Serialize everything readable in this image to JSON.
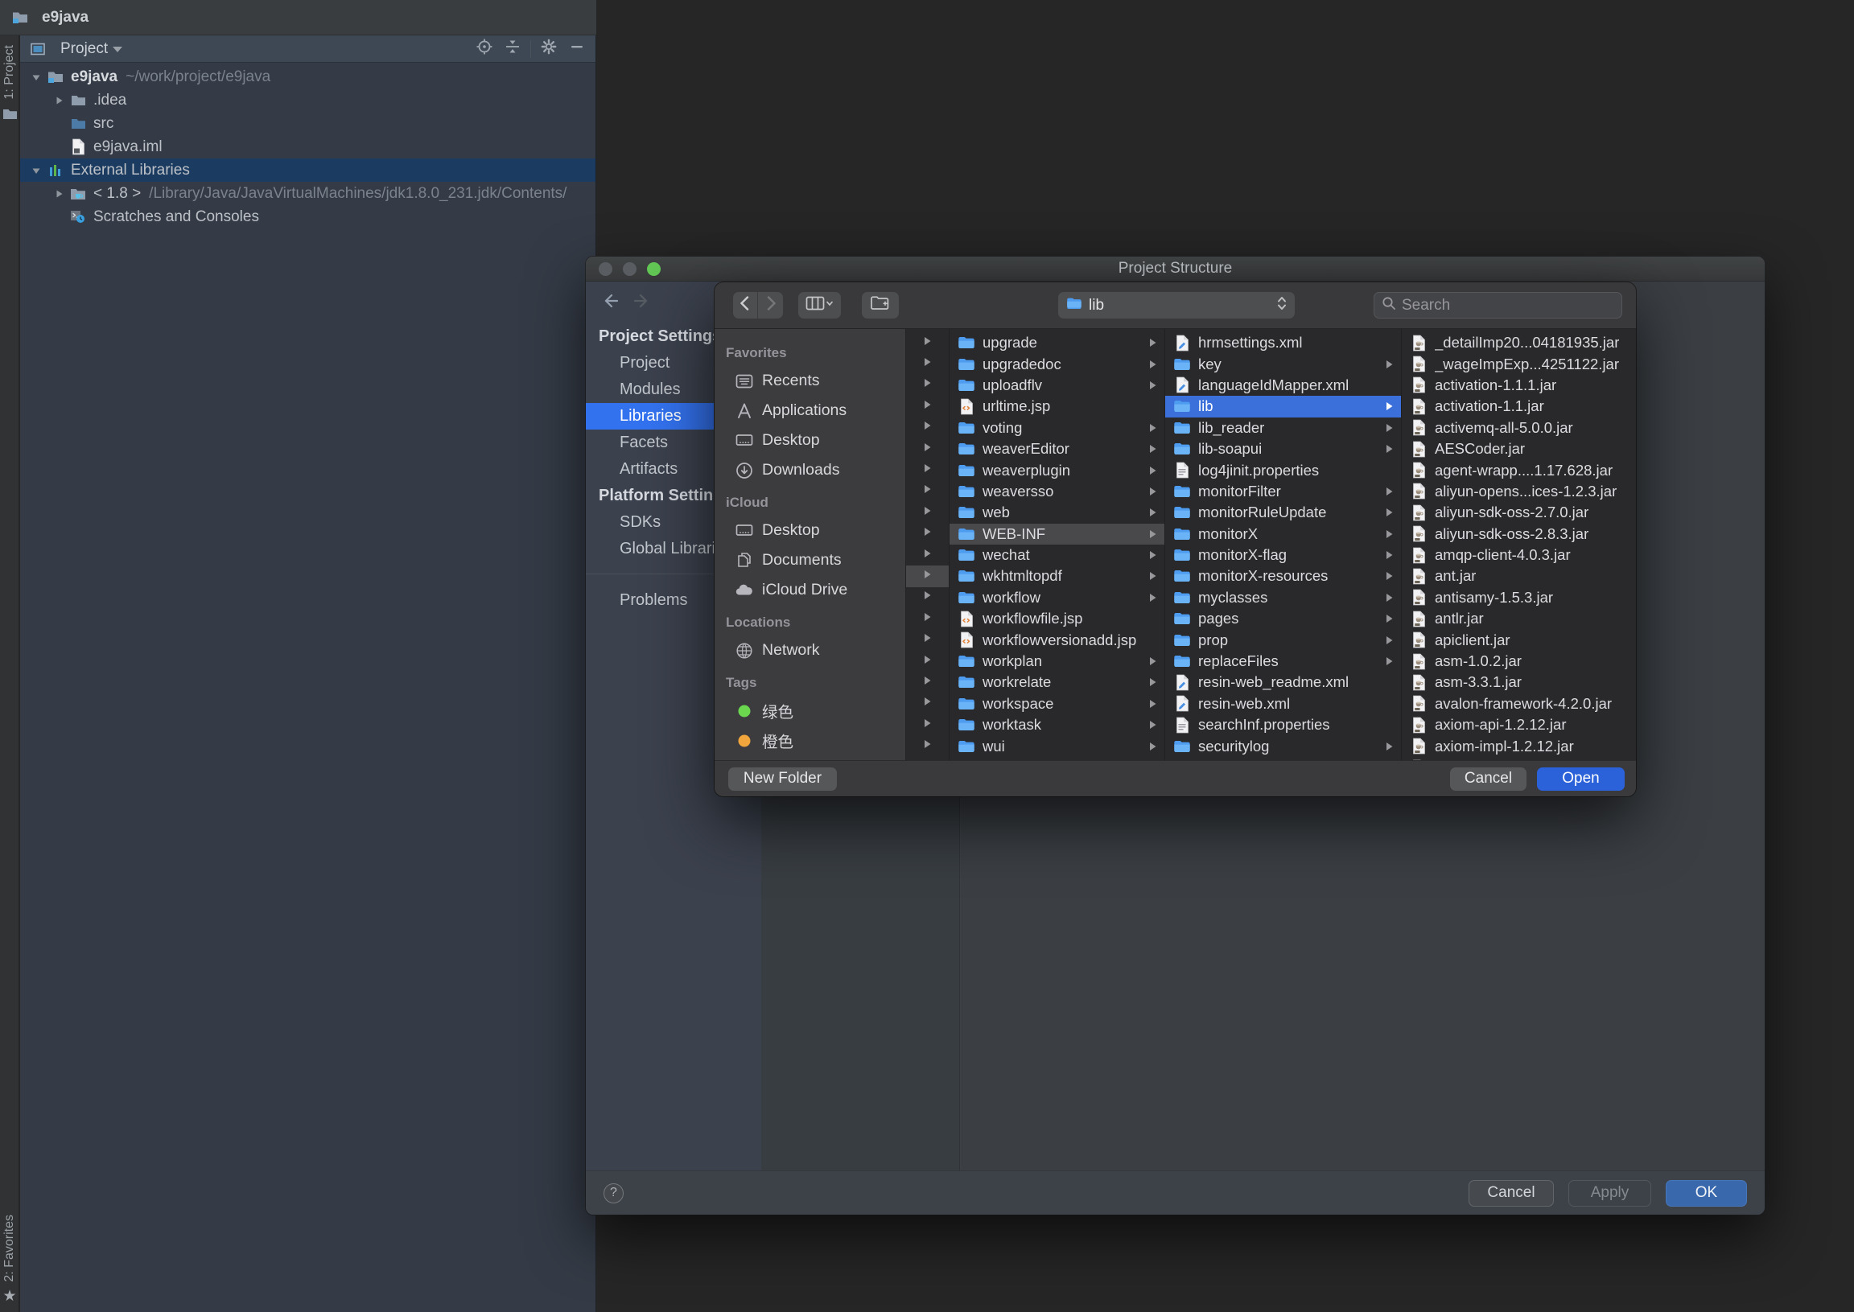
{
  "window": {
    "title": "e9java"
  },
  "tool_stripes": {
    "left_top": "1: Project",
    "left_bottom": "2: Favorites"
  },
  "project_panel": {
    "header_title": "Project",
    "tree": [
      {
        "label": "e9java",
        "hint": "~/work/project/e9java",
        "icon": "project-root",
        "expander": "open",
        "indent": 0,
        "bold": true
      },
      {
        "label": ".idea",
        "icon": "folder-grey",
        "expander": "closed",
        "indent": 1
      },
      {
        "label": "src",
        "icon": "folder-blue",
        "expander": "none",
        "indent": 1
      },
      {
        "label": "e9java.iml",
        "icon": "iml-file",
        "expander": "none",
        "indent": 1
      },
      {
        "label": "External Libraries",
        "icon": "libraries",
        "expander": "open",
        "indent": 0,
        "selected": true
      },
      {
        "label": "< 1.8 >",
        "hint": "/Library/Java/JavaVirtualMachines/jdk1.8.0_231.jdk/Contents/",
        "icon": "jdk",
        "expander": "closed",
        "indent": 1
      },
      {
        "label": "Scratches and Consoles",
        "icon": "scratches",
        "expander": "none",
        "indent": 1
      }
    ]
  },
  "project_structure": {
    "title": "Project Structure",
    "sidebar_sections": [
      {
        "header": "Project Settings",
        "items": [
          {
            "label": "Project"
          },
          {
            "label": "Modules"
          },
          {
            "label": "Libraries",
            "selected": true
          },
          {
            "label": "Facets"
          },
          {
            "label": "Artifacts"
          }
        ]
      },
      {
        "header": "Platform Settings",
        "items": [
          {
            "label": "SDKs"
          },
          {
            "label": "Global Libraries"
          }
        ]
      },
      {
        "header": "",
        "divider": true,
        "items": [
          {
            "label": "Problems"
          }
        ]
      }
    ],
    "footer": {
      "help": "?",
      "cancel": "Cancel",
      "apply": "Apply",
      "ok": "OK"
    }
  },
  "file_chooser": {
    "toolbar": {
      "location": "lib",
      "search_placeholder": "Search"
    },
    "sidebar": [
      {
        "title": "Favorites",
        "items": [
          {
            "label": "Recents",
            "icon": "recents"
          },
          {
            "label": "Applications",
            "icon": "applications"
          },
          {
            "label": "Desktop",
            "icon": "desktop"
          },
          {
            "label": "Downloads",
            "icon": "downloads"
          }
        ]
      },
      {
        "title": "iCloud",
        "items": [
          {
            "label": "Desktop",
            "icon": "desktop"
          },
          {
            "label": "Documents",
            "icon": "documents"
          },
          {
            "label": "iCloud Drive",
            "icon": "icloud"
          }
        ]
      },
      {
        "title": "Locations",
        "items": [
          {
            "label": "Network",
            "icon": "network"
          }
        ]
      },
      {
        "title": "Tags",
        "items": [
          {
            "label": "绿色",
            "icon": "tag",
            "color": "#6bd74f"
          },
          {
            "label": "橙色",
            "icon": "tag",
            "color": "#f0a63c"
          }
        ]
      }
    ],
    "parent_strip": {
      "rows": 20,
      "highlight_index": 11
    },
    "columns": [
      {
        "items": [
          {
            "label": "upgrade",
            "type": "folder",
            "arrow": true
          },
          {
            "label": "upgradedoc",
            "type": "folder",
            "arrow": true
          },
          {
            "label": "uploadflv",
            "type": "folder",
            "arrow": true
          },
          {
            "label": "urltime.jsp",
            "type": "jsp"
          },
          {
            "label": "voting",
            "type": "folder",
            "arrow": true
          },
          {
            "label": "weaverEditor",
            "type": "folder",
            "arrow": true
          },
          {
            "label": "weaverplugin",
            "type": "folder",
            "arrow": true
          },
          {
            "label": "weaversso",
            "type": "folder",
            "arrow": true
          },
          {
            "label": "web",
            "type": "folder",
            "arrow": true
          },
          {
            "label": "WEB-INF",
            "type": "folder",
            "arrow": true,
            "selected": "grey"
          },
          {
            "label": "wechat",
            "type": "folder",
            "arrow": true
          },
          {
            "label": "wkhtmltopdf",
            "type": "folder",
            "arrow": true
          },
          {
            "label": "workflow",
            "type": "folder",
            "arrow": true
          },
          {
            "label": "workflowfile.jsp",
            "type": "jsp"
          },
          {
            "label": "workflowversionadd.jsp",
            "type": "jsp"
          },
          {
            "label": "workplan",
            "type": "folder",
            "arrow": true
          },
          {
            "label": "workrelate",
            "type": "folder",
            "arrow": true
          },
          {
            "label": "workspace",
            "type": "folder",
            "arrow": true
          },
          {
            "label": "worktask",
            "type": "folder",
            "arrow": true
          },
          {
            "label": "wui",
            "type": "folder",
            "arrow": true
          }
        ]
      },
      {
        "items": [
          {
            "label": "hrmsettings.xml",
            "type": "xml"
          },
          {
            "label": "key",
            "type": "folder",
            "arrow": true
          },
          {
            "label": "languageIdMapper.xml",
            "type": "xml"
          },
          {
            "label": "lib",
            "type": "folder",
            "arrow": true,
            "selected": "blue"
          },
          {
            "label": "lib_reader",
            "type": "folder",
            "arrow": true
          },
          {
            "label": "lib-soapui",
            "type": "folder",
            "arrow": true
          },
          {
            "label": "log4jinit.properties",
            "type": "props"
          },
          {
            "label": "monitorFilter",
            "type": "folder",
            "arrow": true
          },
          {
            "label": "monitorRuleUpdate",
            "type": "folder",
            "arrow": true
          },
          {
            "label": "monitorX",
            "type": "folder",
            "arrow": true
          },
          {
            "label": "monitorX-flag",
            "type": "folder",
            "arrow": true
          },
          {
            "label": "monitorX-resources",
            "type": "folder",
            "arrow": true
          },
          {
            "label": "myclasses",
            "type": "folder",
            "arrow": true
          },
          {
            "label": "pages",
            "type": "folder",
            "arrow": true
          },
          {
            "label": "prop",
            "type": "folder",
            "arrow": true
          },
          {
            "label": "replaceFiles",
            "type": "folder",
            "arrow": true
          },
          {
            "label": "resin-web_readme.xml",
            "type": "xml"
          },
          {
            "label": "resin-web.xml",
            "type": "xml"
          },
          {
            "label": "searchInf.properties",
            "type": "props"
          },
          {
            "label": "securitylog",
            "type": "folder",
            "arrow": true
          },
          {
            "label": "",
            "type": "folder",
            "partial": true
          }
        ]
      },
      {
        "items": [
          {
            "label": "_detailImp20...04181935.jar",
            "type": "jar"
          },
          {
            "label": "_wageImpExp...4251122.jar",
            "type": "jar"
          },
          {
            "label": "activation-1.1.1.jar",
            "type": "jar"
          },
          {
            "label": "activation-1.1.jar",
            "type": "jar"
          },
          {
            "label": "activemq-all-5.0.0.jar",
            "type": "jar"
          },
          {
            "label": "AESCoder.jar",
            "type": "jar"
          },
          {
            "label": "agent-wrapp....1.17.628.jar",
            "type": "jar"
          },
          {
            "label": "aliyun-opens...ices-1.2.3.jar",
            "type": "jar"
          },
          {
            "label": "aliyun-sdk-oss-2.7.0.jar",
            "type": "jar"
          },
          {
            "label": "aliyun-sdk-oss-2.8.3.jar",
            "type": "jar"
          },
          {
            "label": "amqp-client-4.0.3.jar",
            "type": "jar"
          },
          {
            "label": "ant.jar",
            "type": "jar"
          },
          {
            "label": "antisamy-1.5.3.jar",
            "type": "jar"
          },
          {
            "label": "antlr.jar",
            "type": "jar"
          },
          {
            "label": "apiclient.jar",
            "type": "jar"
          },
          {
            "label": "asm-1.0.2.jar",
            "type": "jar"
          },
          {
            "label": "asm-3.3.1.jar",
            "type": "jar"
          },
          {
            "label": "avalon-framework-4.2.0.jar",
            "type": "jar"
          },
          {
            "label": "axiom-api-1.2.12.jar",
            "type": "jar"
          },
          {
            "label": "axiom-impl-1.2.12.jar",
            "type": "jar"
          },
          {
            "label": "",
            "type": "jar",
            "partial": true
          }
        ]
      }
    ],
    "footer": {
      "new_folder": "New Folder",
      "cancel": "Cancel",
      "open": "Open"
    }
  },
  "colors": {
    "accent_blue": "#3372ef",
    "mac_accent": "#3b6fd9",
    "open_button": "#2b61d9",
    "ok_button": "#3a68ac",
    "tree_selection": "#1b3c60",
    "tag_green": "#6bd74f",
    "tag_orange": "#f0a63c",
    "traffic_green": "#62c654"
  }
}
